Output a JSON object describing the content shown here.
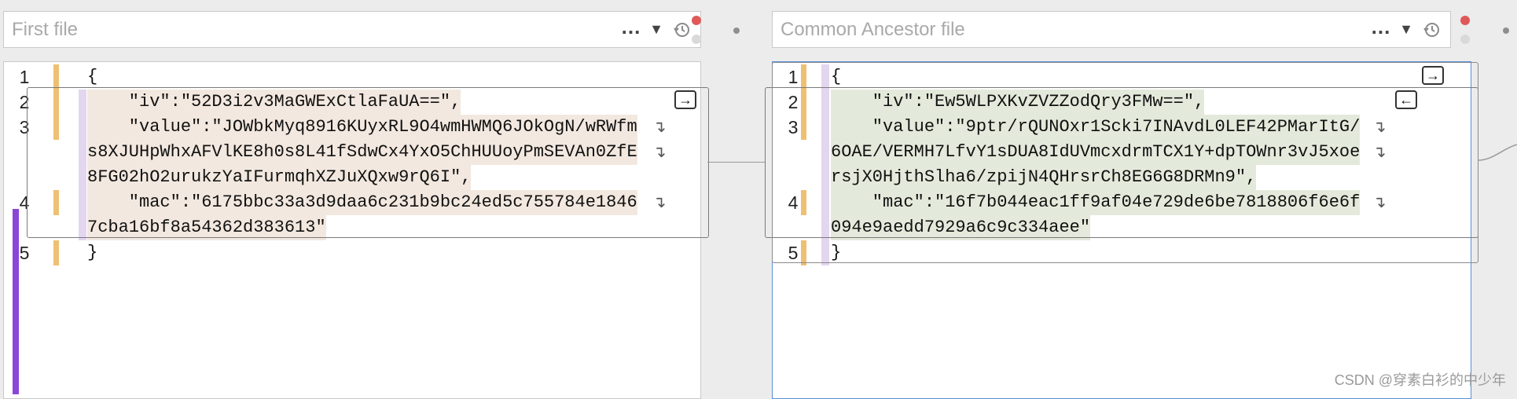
{
  "left_pane": {
    "placeholder": "First file",
    "dots_label": "...",
    "lines": [
      {
        "num": "1",
        "segments": [
          "{"
        ]
      },
      {
        "num": "2",
        "segments": [
          "    \"iv\":\"52D3i2v3MaGWExCtlaFaUA==\","
        ]
      },
      {
        "num": "3",
        "segments": [
          "    \"value\":\"JOWbkMyq8916KUyxRL9O4wmHWMQ6JOkOgN/wRWfm",
          "s8XJUHpWhxAFVlKE8h0s8L41fSdwCx4YxO5ChHUUoyPmSEVAn0ZfE",
          "8FG02hO2urukzYaIFurmqhXZJuXQxw9rQ6I\","
        ]
      },
      {
        "num": "4",
        "segments": [
          "    \"mac\":\"6175bbc33a3d9daa6c231b9bc24ed5c755784e1846",
          "7cba16bf8a54362d383613\""
        ]
      },
      {
        "num": "5",
        "segments": [
          "}"
        ]
      }
    ]
  },
  "right_pane": {
    "placeholder": "Common Ancestor file",
    "dots_label": "...",
    "lines": [
      {
        "num": "1",
        "segments": [
          "{"
        ]
      },
      {
        "num": "2",
        "segments": [
          "    \"iv\":\"Ew5WLPXKvZVZZodQry3FMw==\","
        ]
      },
      {
        "num": "3",
        "segments": [
          "    \"value\":\"9ptr/rQUNOxr1Scki7INAvdL0LEF42PMarItG/",
          "6OAE/VERMH7LfvY1sDUA8IdUVmcxdrmTCX1Y+dpTOWnr3vJ5xoe",
          "rsjX0HjthSlha6/zpijN4QHrsrCh8EG6G8DRMn9\","
        ]
      },
      {
        "num": "4",
        "segments": [
          "    \"mac\":\"16f7b044eac1ff9af04e729de6be7818806f6e6f",
          "094e9aedd7929a6c9c334aee\""
        ]
      },
      {
        "num": "5",
        "segments": [
          "}"
        ]
      }
    ]
  },
  "icons": {
    "dots": "ellipsis-icon",
    "caret": "dropdown-caret-icon",
    "history": "history-icon",
    "wrap": "line-wrap-icon",
    "arrow_right": "apply-right-arrow-icon",
    "arrow_left": "apply-left-arrow-icon"
  },
  "colors": {
    "left_highlight": "#f2e8df",
    "right_highlight": "#e4eadb",
    "gutter_marker": "#eec073",
    "change_bar": "#e3d6ef",
    "red_dot": "#e05959",
    "purple_bar": "#8b45d9",
    "active_border": "#5b8ed6"
  },
  "watermark": "CSDN @穿素白衫的中少年"
}
